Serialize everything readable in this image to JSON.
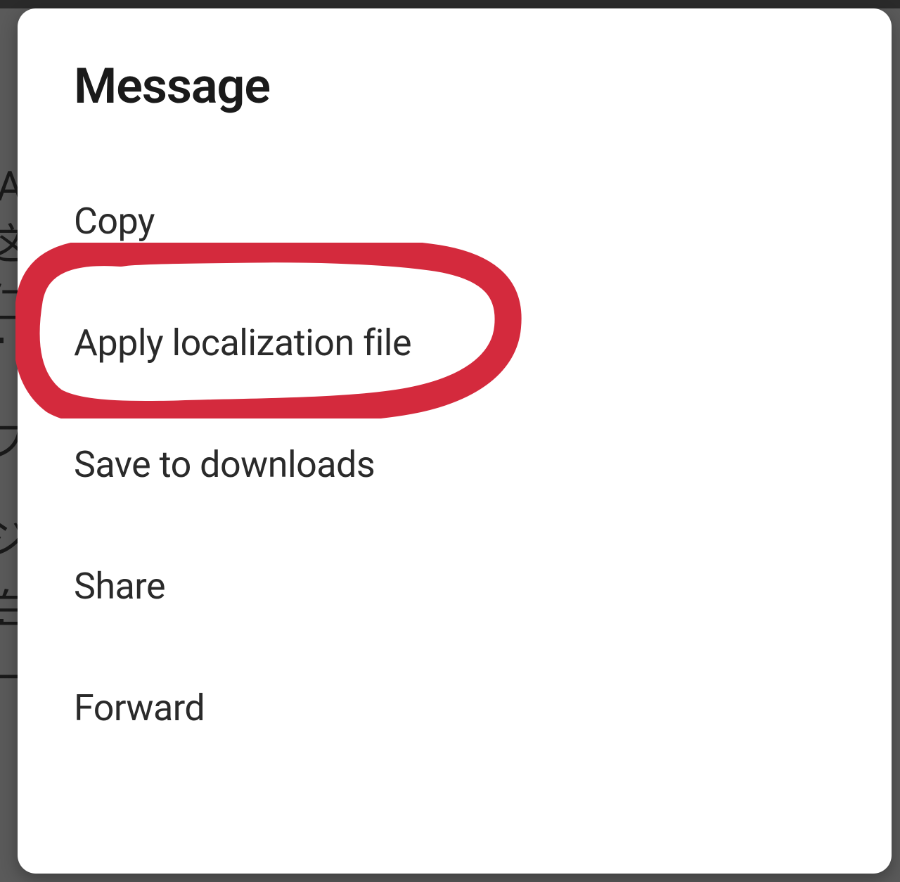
{
  "modal": {
    "title": "Message",
    "items": [
      {
        "label": "Copy"
      },
      {
        "label": "Apply localization file"
      },
      {
        "label": "Save to downloads"
      },
      {
        "label": "Share"
      },
      {
        "label": "Forward"
      }
    ]
  },
  "annotation": {
    "color": "#d42a3d"
  }
}
